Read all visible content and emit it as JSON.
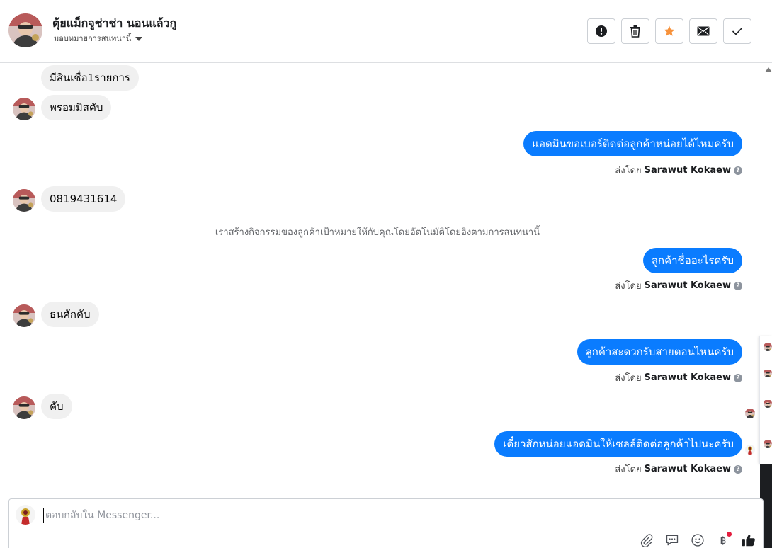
{
  "header": {
    "name": "ตุ้ยแม็กจูช่าช่า นอนแล้วกู",
    "assign_label": "มอบหมายการสนทนานี้",
    "actions": [
      {
        "name": "spam-button",
        "icon": "exclamation-icon"
      },
      {
        "name": "delete-button",
        "icon": "trash-icon"
      },
      {
        "name": "star-button",
        "icon": "star-icon",
        "color": "#f7923b"
      },
      {
        "name": "mark-unread-button",
        "icon": "envelope-icon"
      },
      {
        "name": "mark-done-button",
        "icon": "check-icon"
      }
    ]
  },
  "messages": {
    "m1": "มีสินเชื่อ1รายการ",
    "m2": "พรอมมิสคับ",
    "m3": "แอดมินขอเบอร์ติดต่อลูกค้าหน่อยได้ไหมครับ",
    "m4": "0819431614",
    "m5": "ลูกค้าชื่ออะไรครับ",
    "m6": "ธนศักคับ",
    "m7": "ลูกค้าสะดวกรับสายตอนไหนครับ",
    "m8": "คับ",
    "m9": "เดี๋ยวสักหน่อยแอดมินให้เซลล์ติดต่อลูกค้าไปนะครับ"
  },
  "system_note": "เราสร้างกิจกรรมของลูกค้าเป้าหมายให้กับคุณโดยอัตโนมัติโดยอิงตามการสนทนานี้",
  "sent_by": {
    "prefix": "ส่งโดย",
    "sender": "Sarawut Kokaew"
  },
  "composer": {
    "placeholder": "ตอบกลับใน Messenger..."
  },
  "colors": {
    "outgoing_bubble": "#0a7cff",
    "incoming_bubble": "#f0f0f0",
    "star": "#f7923b"
  }
}
